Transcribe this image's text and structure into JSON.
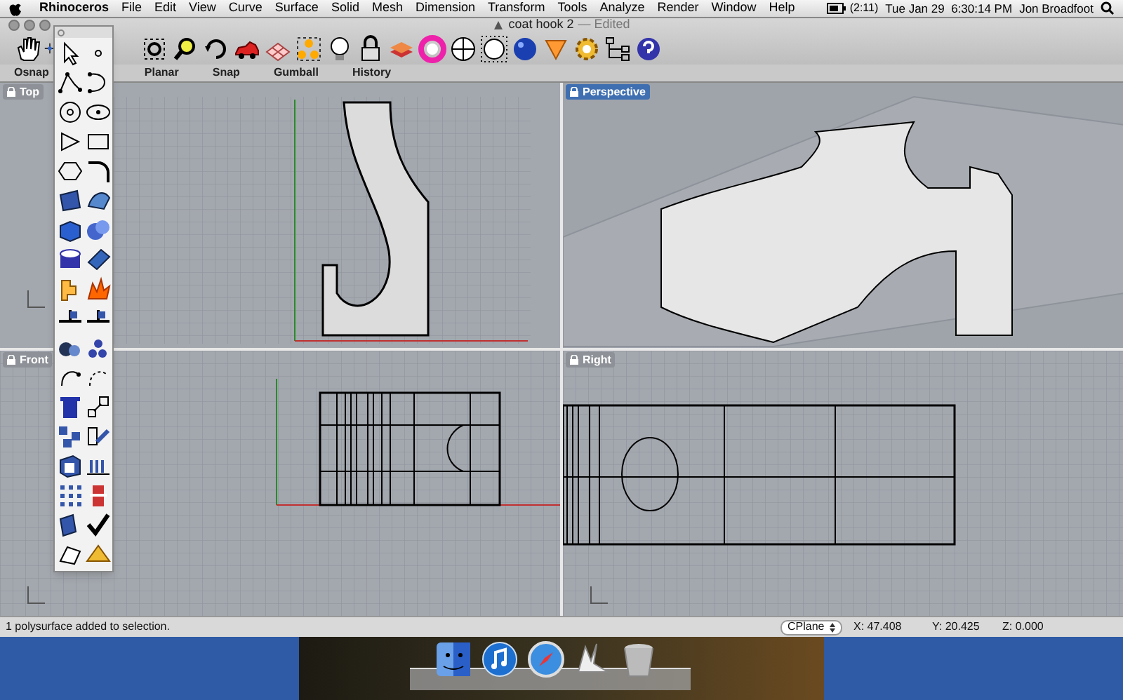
{
  "menu_bar": {
    "items": [
      {
        "label": "Rhinoceros",
        "bold": true
      },
      {
        "label": "File",
        "bold": false
      },
      {
        "label": "Edit",
        "bold": false
      },
      {
        "label": "View",
        "bold": false
      },
      {
        "label": "Curve",
        "bold": false
      },
      {
        "label": "Surface",
        "bold": false
      },
      {
        "label": "Solid",
        "bold": false
      },
      {
        "label": "Mesh",
        "bold": false
      },
      {
        "label": "Dimension",
        "bold": false
      },
      {
        "label": "Transform",
        "bold": false
      },
      {
        "label": "Tools",
        "bold": false
      },
      {
        "label": "Analyze",
        "bold": false
      },
      {
        "label": "Render",
        "bold": false
      },
      {
        "label": "Window",
        "bold": false
      },
      {
        "label": "Help",
        "bold": false
      }
    ],
    "battery": "(2:11)",
    "clock": "Tue Jan 29  6:30:14 PM",
    "user": "Jon Broadfoot"
  },
  "window": {
    "title": "coat hook 2",
    "subtitle": "— Edited"
  },
  "toolbar_tabs": [
    {
      "label": "Osnap"
    },
    {
      "label": "Planar"
    },
    {
      "label": "Snap"
    },
    {
      "label": "Gumball"
    },
    {
      "label": "History"
    }
  ],
  "viewports": [
    {
      "label": "Top",
      "kind": "top",
      "selected": false
    },
    {
      "label": "Perspective",
      "kind": "perspective",
      "selected": true
    },
    {
      "label": "Front",
      "kind": "front",
      "selected": false
    },
    {
      "label": "Right",
      "kind": "right",
      "selected": false
    }
  ],
  "status_bar": {
    "message": "1 polysurface added to selection.",
    "cplane": "CPlane",
    "x": "X: 47.408",
    "y": "Y: 20.425",
    "z": "Z: 0.000"
  }
}
